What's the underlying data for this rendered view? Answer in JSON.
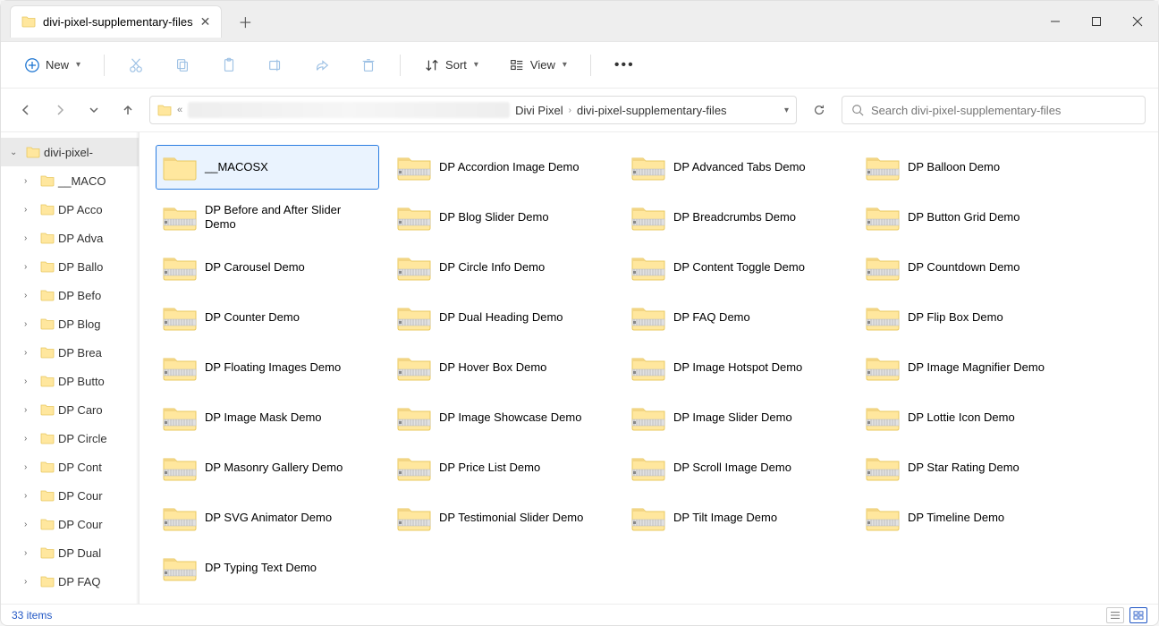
{
  "window": {
    "tab_title": "divi-pixel-supplementary-files",
    "minimize": "—",
    "maximize": "▢",
    "close": "✕"
  },
  "toolbar": {
    "new_label": "New",
    "sort_label": "Sort",
    "view_label": "View"
  },
  "breadcrumbs": {
    "parent": "Divi Pixel",
    "current": "divi-pixel-supplementary-files"
  },
  "search": {
    "placeholder": "Search divi-pixel-supplementary-files"
  },
  "sidebar": {
    "root": "divi-pixel-",
    "items": [
      "__MACO",
      "DP Acco",
      "DP Adva",
      "DP Ballo",
      "DP Befo",
      "DP Blog",
      "DP Brea",
      "DP Butto",
      "DP Caro",
      "DP Circle",
      "DP Cont",
      "DP Cour",
      "DP Cour",
      "DP Dual",
      "DP FAQ"
    ]
  },
  "files": [
    {
      "name": "__MACOSX",
      "type": "folder",
      "selected": true
    },
    {
      "name": "DP Accordion Image Demo",
      "type": "zip"
    },
    {
      "name": "DP Advanced Tabs Demo",
      "type": "zip"
    },
    {
      "name": "DP Balloon Demo",
      "type": "zip"
    },
    {
      "name": "DP Before and After Slider Demo",
      "type": "zip"
    },
    {
      "name": "DP Blog Slider Demo",
      "type": "zip"
    },
    {
      "name": "DP Breadcrumbs Demo",
      "type": "zip"
    },
    {
      "name": "DP Button Grid Demo",
      "type": "zip"
    },
    {
      "name": "DP Carousel Demo",
      "type": "zip"
    },
    {
      "name": "DP Circle Info Demo",
      "type": "zip"
    },
    {
      "name": "DP Content Toggle Demo",
      "type": "zip"
    },
    {
      "name": "DP Countdown Demo",
      "type": "zip"
    },
    {
      "name": "DP Counter Demo",
      "type": "zip"
    },
    {
      "name": "DP Dual Heading Demo",
      "type": "zip"
    },
    {
      "name": "DP FAQ Demo",
      "type": "zip"
    },
    {
      "name": "DP Flip Box Demo",
      "type": "zip"
    },
    {
      "name": "DP Floating Images Demo",
      "type": "zip"
    },
    {
      "name": "DP Hover Box Demo",
      "type": "zip"
    },
    {
      "name": "DP Image Hotspot Demo",
      "type": "zip"
    },
    {
      "name": "DP Image Magnifier Demo",
      "type": "zip"
    },
    {
      "name": "DP Image Mask Demo",
      "type": "zip"
    },
    {
      "name": "DP Image Showcase Demo",
      "type": "zip"
    },
    {
      "name": "DP Image Slider Demo",
      "type": "zip"
    },
    {
      "name": "DP Lottie Icon Demo",
      "type": "zip"
    },
    {
      "name": "DP Masonry Gallery Demo",
      "type": "zip"
    },
    {
      "name": "DP Price List Demo",
      "type": "zip"
    },
    {
      "name": "DP Scroll Image Demo",
      "type": "zip"
    },
    {
      "name": "DP Star Rating Demo",
      "type": "zip"
    },
    {
      "name": "DP SVG Animator Demo",
      "type": "zip"
    },
    {
      "name": "DP Testimonial Slider Demo",
      "type": "zip"
    },
    {
      "name": "DP Tilt Image Demo",
      "type": "zip"
    },
    {
      "name": "DP Timeline Demo",
      "type": "zip"
    },
    {
      "name": "DP Typing Text Demo",
      "type": "zip"
    }
  ],
  "status": {
    "count": "33 items"
  }
}
